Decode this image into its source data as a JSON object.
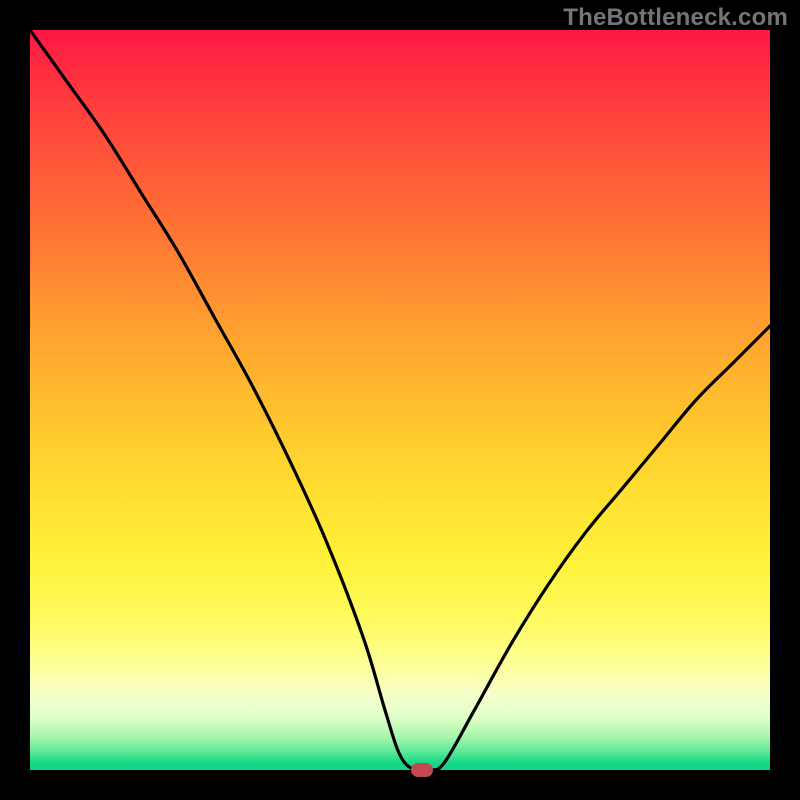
{
  "watermark": "TheBottleneck.com",
  "chart_data": {
    "type": "line",
    "title": "",
    "xlabel": "",
    "ylabel": "",
    "xlim": [
      0,
      100
    ],
    "ylim": [
      0,
      100
    ],
    "grid": false,
    "legend": false,
    "background_gradient": {
      "direction": "vertical",
      "stops": [
        {
          "pos": 0.0,
          "color": "#ff1744",
          "meaning": "severe-bottleneck"
        },
        {
          "pos": 0.5,
          "color": "#ffb031",
          "meaning": "moderate"
        },
        {
          "pos": 0.8,
          "color": "#fffb62",
          "meaning": "mild"
        },
        {
          "pos": 1.0,
          "color": "#11d386",
          "meaning": "balanced"
        }
      ]
    },
    "series": [
      {
        "name": "bottleneck-curve",
        "color": "#000000",
        "x": [
          0,
          5,
          10,
          15,
          20,
          25,
          30,
          35,
          40,
          45,
          48,
          50,
          52,
          54,
          56,
          60,
          65,
          70,
          75,
          80,
          85,
          90,
          95,
          100
        ],
        "y": [
          100,
          93,
          86,
          78,
          70,
          61,
          52,
          42,
          31,
          18,
          8,
          2,
          0,
          0,
          1,
          8,
          17,
          25,
          32,
          38,
          44,
          50,
          55,
          60
        ]
      }
    ],
    "marker": {
      "name": "current-configuration",
      "x": 53,
      "y": 0,
      "color": "#c14a52",
      "shape": "rounded-rect"
    },
    "notes": "V-shaped bottleneck curve over a vertical heat gradient. Minimum (fully balanced) occurs near x≈53. Left branch starts at top-left corner; right branch rises to about 60% height at the right edge. Values are estimated from the image (no axes/ticks are drawn)."
  }
}
